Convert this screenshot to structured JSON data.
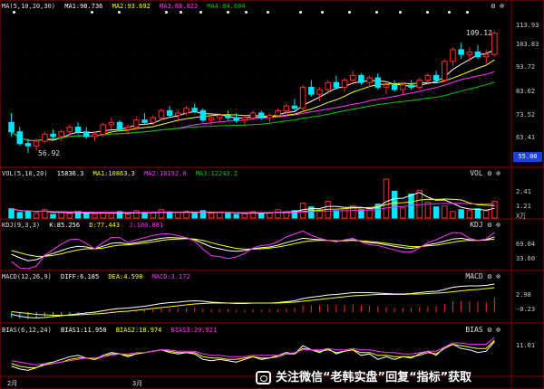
{
  "colors": {
    "bg": "#000000",
    "grid": "#3a0000",
    "up": "#ff2b2b",
    "down": "#00e5ff",
    "white": "#ffffff",
    "yellow": "#ffff00",
    "magenta": "#ff33ff",
    "green": "#00c800",
    "axis_tag": "#1c3fd6"
  },
  "main": {
    "indicator": "MA(5,10,20,30)",
    "ma1": "MA1:98.736",
    "ma2": "MA2:93.692",
    "ma3": "MA3:88.823",
    "ma4": "MA4:84.604",
    "y_ticks": [
      "113.93",
      "103.83",
      "93.72",
      "83.62",
      "73.52",
      "63.41"
    ],
    "price_tag": "55.00",
    "high_label": "109.12",
    "low_label": "56.92",
    "controls": [
      "settings-icon",
      "close-icon"
    ]
  },
  "vol": {
    "indicator": "VOL(5,10,20)",
    "value": "15836.3",
    "ma1": "MA1:10863.3",
    "ma2": "MA2:10192.0",
    "ma3": "MA3:12243.2",
    "right_label": "VOL",
    "y_ticks": [
      "2.41",
      "1.21",
      "X万"
    ]
  },
  "kdj": {
    "indicator": "KDJ(9,3,3)",
    "k": "K:85.256",
    "d": "D:77.443",
    "j": "J:100.881",
    "right_label": "KDJ",
    "y_ticks": [
      "69.04",
      "33.60"
    ]
  },
  "macd": {
    "indicator": "MACD(12,26,9)",
    "diff": "DIFF:6.185",
    "dea": "DEA:4.598",
    "macd": "MACD:3.172",
    "right_label": "MACD",
    "y_ticks": [
      "2.98",
      "-0.23"
    ]
  },
  "bias": {
    "indicator": "BIAS(6,12,24)",
    "b1": "BIAS1:11.950",
    "b2": "BIAS2:18.974",
    "b3": "BIAS3:29.921",
    "right_label": "BIAS",
    "y_ticks": [
      "11.01"
    ]
  },
  "time_axis": {
    "months": [
      "2月",
      "3月"
    ]
  },
  "watermark": "关注微信“老韩实盘”回复“指标”获取",
  "chart_data": {
    "type": "candlestick",
    "candles": [
      [
        70,
        74,
        64,
        66
      ],
      [
        66,
        68,
        60,
        61
      ],
      [
        61,
        63,
        57,
        60
      ],
      [
        60,
        63,
        58,
        62
      ],
      [
        62,
        66,
        61,
        65
      ],
      [
        65,
        67,
        63,
        64
      ],
      [
        64,
        67,
        62,
        66
      ],
      [
        66,
        69,
        64,
        68
      ],
      [
        68,
        70,
        65,
        66
      ],
      [
        66,
        68,
        63,
        64
      ],
      [
        64,
        66,
        62,
        65
      ],
      [
        65,
        70,
        64,
        69
      ],
      [
        69,
        72,
        67,
        70
      ],
      [
        70,
        71,
        66,
        67
      ],
      [
        67,
        69,
        65,
        68
      ],
      [
        68,
        72,
        67,
        71
      ],
      [
        71,
        74,
        69,
        70
      ],
      [
        70,
        73,
        69,
        72
      ],
      [
        72,
        76,
        71,
        75
      ],
      [
        75,
        77,
        72,
        73
      ],
      [
        73,
        75,
        71,
        74
      ],
      [
        74,
        77,
        73,
        76
      ],
      [
        76,
        78,
        74,
        75
      ],
      [
        75,
        76,
        70,
        71
      ],
      [
        71,
        73,
        69,
        72
      ],
      [
        72,
        74,
        70,
        73
      ],
      [
        73,
        75,
        71,
        72
      ],
      [
        72,
        74,
        70,
        71
      ],
      [
        71,
        73,
        69,
        72
      ],
      [
        72,
        75,
        71,
        74
      ],
      [
        74,
        75,
        71,
        72
      ],
      [
        72,
        74,
        70,
        73
      ],
      [
        73,
        76,
        72,
        75
      ],
      [
        75,
        78,
        73,
        77
      ],
      [
        77,
        80,
        75,
        76
      ],
      [
        76,
        86,
        75,
        85
      ],
      [
        85,
        88,
        81,
        82
      ],
      [
        82,
        85,
        79,
        84
      ],
      [
        84,
        88,
        82,
        87
      ],
      [
        87,
        90,
        84,
        85
      ],
      [
        85,
        89,
        83,
        88
      ],
      [
        88,
        92,
        86,
        90
      ],
      [
        90,
        91,
        86,
        87
      ],
      [
        87,
        90,
        85,
        89
      ],
      [
        89,
        91,
        84,
        85
      ],
      [
        85,
        87,
        82,
        86
      ],
      [
        86,
        88,
        83,
        84
      ],
      [
        84,
        87,
        82,
        86
      ],
      [
        86,
        88,
        84,
        85
      ],
      [
        85,
        89,
        84,
        88
      ],
      [
        88,
        91,
        86,
        90
      ],
      [
        90,
        92,
        87,
        88
      ],
      [
        88,
        97,
        87,
        96
      ],
      [
        96,
        102,
        94,
        101
      ],
      [
        101,
        104,
        97,
        99
      ],
      [
        99,
        102,
        96,
        100
      ],
      [
        100,
        103,
        97,
        98
      ],
      [
        98,
        101,
        95,
        99
      ],
      [
        99,
        109,
        98,
        108
      ]
    ],
    "vol_values": [
      1.0,
      0.6,
      0.7,
      0.5,
      0.9,
      0.4,
      0.6,
      0.5,
      0.7,
      0.5,
      0.4,
      0.6,
      0.5,
      0.7,
      0.4,
      0.8,
      0.5,
      0.6,
      0.9,
      0.5,
      0.6,
      0.7,
      0.5,
      0.8,
      0.5,
      0.6,
      0.5,
      0.4,
      0.5,
      0.7,
      0.5,
      0.6,
      0.9,
      0.6,
      0.8,
      1.6,
      1.2,
      0.9,
      1.8,
      0.8,
      1.0,
      1.3,
      0.9,
      1.0,
      1.5,
      4.2,
      2.9,
      1.1,
      2.6,
      3.0,
      1.7,
      1.2,
      1.3,
      0.7,
      0.9,
      0.8,
      1.0,
      0.8,
      1.8
    ],
    "macd_values": [
      -1.2,
      -1.4,
      -1.5,
      -1.3,
      -1.0,
      -0.9,
      -0.7,
      -0.6,
      -0.5,
      -0.3,
      -0.2,
      0.1,
      0.2,
      0.3,
      0.2,
      0.4,
      0.5,
      0.6,
      0.8,
      0.9,
      0.8,
      0.9,
      1.0,
      0.8,
      0.6,
      0.7,
      0.6,
      0.5,
      0.5,
      0.6,
      0.5,
      0.5,
      0.6,
      0.8,
      1.0,
      1.4,
      1.5,
      1.5,
      1.6,
      1.5,
      1.6,
      1.7,
      1.5,
      1.4,
      1.3,
      1.1,
      0.9,
      0.9,
      1.0,
      1.1,
      1.2,
      1.2,
      1.8,
      2.4,
      2.5,
      2.4,
      2.3,
      2.3,
      3.2
    ],
    "kdj_k": [
      40,
      30,
      22,
      25,
      35,
      42,
      50,
      58,
      62,
      60,
      55,
      62,
      70,
      72,
      68,
      72,
      76,
      80,
      84,
      86,
      85,
      84,
      80,
      70,
      60,
      55,
      50,
      48,
      50,
      55,
      58,
      60,
      65,
      72,
      78,
      84,
      82,
      80,
      78,
      76,
      78,
      80,
      76,
      72,
      70,
      66,
      62,
      58,
      56,
      60,
      66,
      70,
      76,
      82,
      84,
      80,
      78,
      80,
      88
    ],
    "kdj_d": [
      50,
      44,
      38,
      34,
      34,
      37,
      41,
      47,
      52,
      55,
      55,
      57,
      62,
      65,
      66,
      68,
      71,
      74,
      78,
      81,
      82,
      83,
      82,
      78,
      72,
      66,
      61,
      56,
      54,
      54,
      55,
      57,
      60,
      64,
      69,
      74,
      77,
      78,
      78,
      77,
      77,
      78,
      77,
      75,
      73,
      70,
      67,
      64,
      61,
      61,
      63,
      65,
      69,
      73,
      77,
      78,
      78,
      79,
      82
    ],
    "macd_diff": [
      -0.5,
      -0.9,
      -1.2,
      -1.3,
      -1.2,
      -1.0,
      -0.8,
      -0.6,
      -0.4,
      -0.2,
      0.0,
      0.3,
      0.6,
      0.8,
      0.9,
      1.1,
      1.3,
      1.6,
      1.9,
      2.1,
      2.2,
      2.4,
      2.5,
      2.4,
      2.2,
      2.1,
      2.0,
      1.9,
      1.9,
      2.0,
      2.0,
      2.0,
      2.1,
      2.3,
      2.5,
      3.0,
      3.3,
      3.5,
      3.8,
      3.9,
      4.1,
      4.3,
      4.3,
      4.3,
      4.2,
      4.1,
      4.0,
      4.0,
      4.1,
      4.3,
      4.5,
      4.6,
      5.0,
      5.5,
      5.7,
      5.8,
      5.8,
      5.9,
      6.2
    ],
    "macd_dea": [
      0.1,
      -0.1,
      -0.3,
      -0.5,
      -0.6,
      -0.7,
      -0.7,
      -0.7,
      -0.6,
      -0.5,
      -0.4,
      -0.3,
      -0.1,
      0.1,
      0.2,
      0.4,
      0.6,
      0.8,
      1.0,
      1.2,
      1.4,
      1.6,
      1.8,
      1.9,
      2.0,
      2.0,
      2.0,
      2.0,
      2.0,
      2.0,
      2.0,
      2.0,
      2.0,
      2.1,
      2.2,
      2.4,
      2.6,
      2.8,
      3.0,
      3.2,
      3.4,
      3.6,
      3.7,
      3.8,
      3.9,
      3.9,
      3.9,
      3.9,
      4.0,
      4.0,
      4.1,
      4.2,
      4.3,
      4.5,
      4.7,
      4.9,
      5.0,
      5.2,
      5.4
    ],
    "bias1": [
      -6,
      -8,
      -9,
      -7,
      -4,
      -3,
      -1,
      1,
      2,
      0,
      -1,
      2,
      4,
      3,
      1,
      3,
      4,
      5,
      6,
      4,
      3,
      4,
      3,
      -1,
      -2,
      -1,
      -2,
      -3,
      -1,
      1,
      -1,
      0,
      2,
      4,
      3,
      9,
      6,
      4,
      7,
      3,
      5,
      6,
      2,
      3,
      -1,
      1,
      -1,
      1,
      0,
      3,
      5,
      2,
      8,
      10,
      7,
      6,
      4,
      5,
      12
    ],
    "bias2": [
      -4,
      -6,
      -7,
      -7,
      -5,
      -4,
      -3,
      -1,
      0,
      0,
      -1,
      1,
      3,
      3,
      2,
      3,
      4,
      5,
      6,
      5,
      4,
      4,
      4,
      1,
      0,
      0,
      -1,
      -1,
      0,
      1,
      0,
      0,
      1,
      3,
      3,
      7,
      6,
      5,
      6,
      4,
      5,
      6,
      4,
      4,
      2,
      2,
      1,
      1,
      1,
      2,
      4,
      3,
      7,
      10,
      9,
      8,
      7,
      7,
      13
    ],
    "bias3": [
      -2,
      -3,
      -4,
      -5,
      -4,
      -4,
      -3,
      -2,
      -1,
      0,
      0,
      1,
      2,
      3,
      3,
      4,
      4,
      5,
      6,
      6,
      5,
      5,
      5,
      3,
      2,
      2,
      1,
      1,
      1,
      2,
      2,
      2,
      2,
      3,
      4,
      6,
      6,
      6,
      7,
      6,
      6,
      7,
      6,
      6,
      5,
      4,
      4,
      3,
      3,
      4,
      5,
      5,
      8,
      11,
      11,
      10,
      10,
      10,
      15
    ]
  }
}
